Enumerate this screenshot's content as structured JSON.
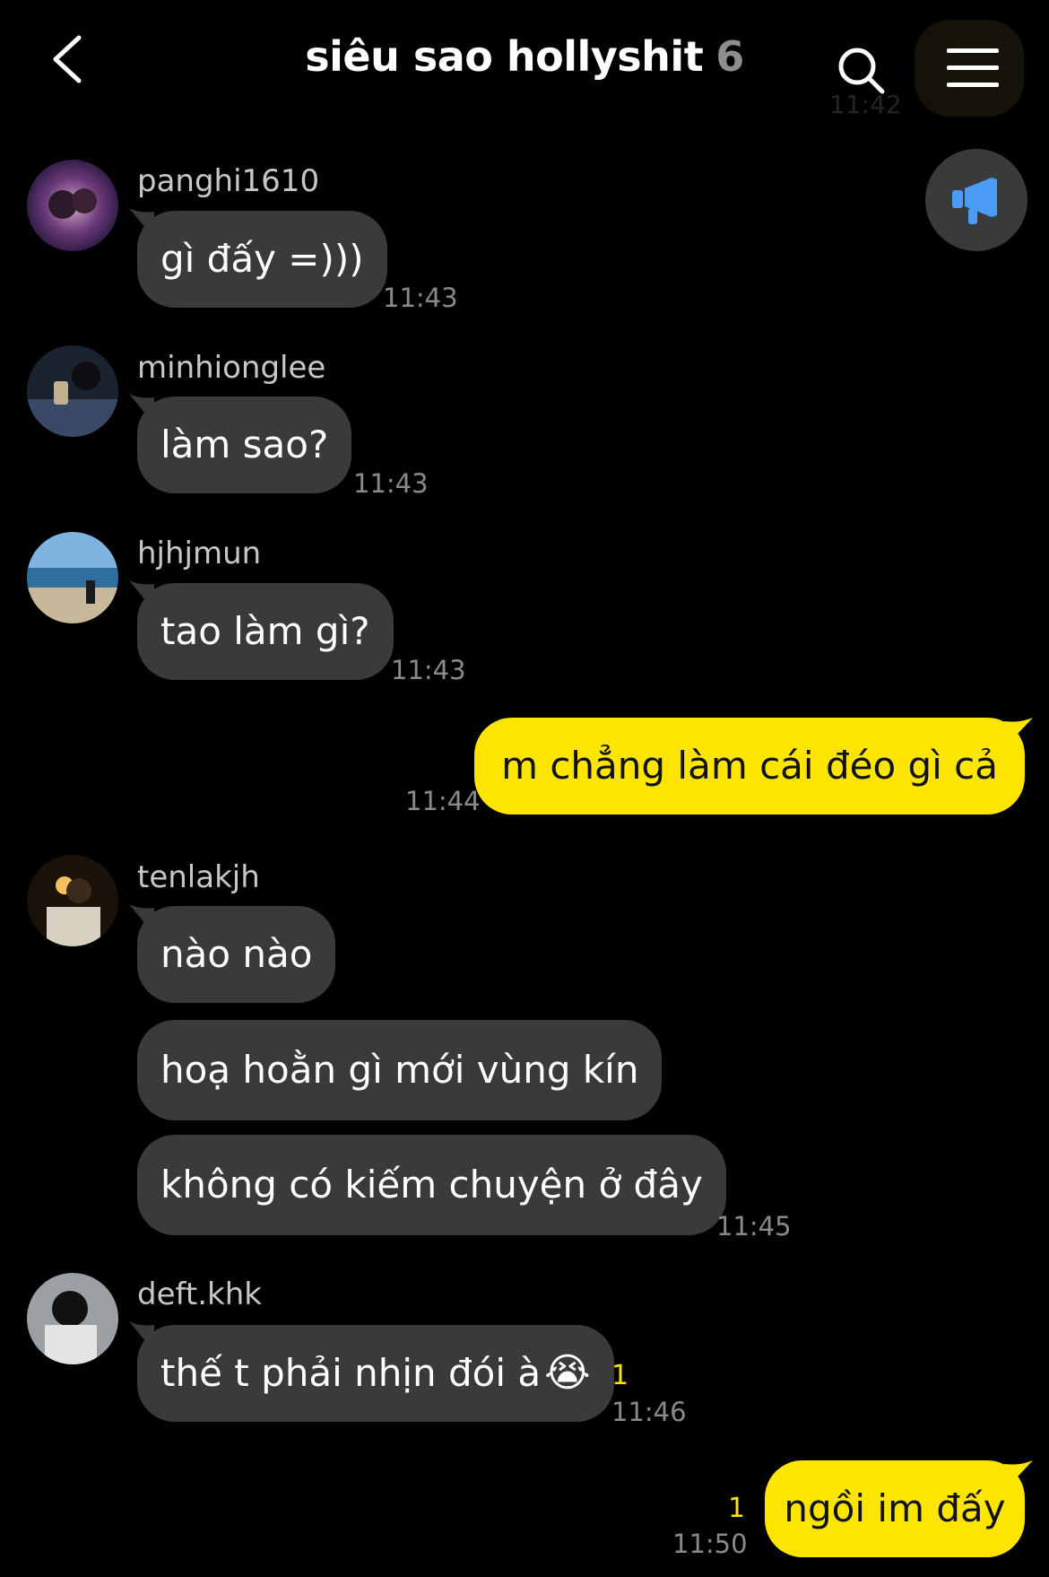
{
  "header": {
    "title": "siêu sao hollyshit",
    "member_count": "6",
    "back_icon": "chevron-left-icon",
    "search_icon": "search-icon",
    "menu_icon": "hamburger-menu-icon",
    "ghost_time": "11:42"
  },
  "notice_icon": "megaphone-icon",
  "colors": {
    "background": "#000000",
    "incoming_bubble": "#3a3a3c",
    "outgoing_bubble": "#fee500",
    "timestamp": "#8a8a8a",
    "unread": "#fee500"
  },
  "messages": [
    {
      "sender": "panghi1610",
      "text": "gì đấy =)))",
      "time": "11:43"
    },
    {
      "sender": "minhionglee",
      "text": "làm sao?",
      "time": "11:43"
    },
    {
      "sender": "hjhjmun",
      "text": "tao làm gì?",
      "time": "11:43"
    },
    {
      "sender": "me",
      "text": "m chẳng làm cái đéo gì cả",
      "time": "11:44"
    },
    {
      "sender": "tenlakjh",
      "lines": [
        "nào nào",
        "hoạ hoằn gì mới vùng kín",
        "không có kiếm chuyện ở đây"
      ],
      "time": "11:45"
    },
    {
      "sender": "deft.khk",
      "text": "thế t phải nhịn đói à",
      "emoji": "😭",
      "unread": "1",
      "time": "11:46"
    },
    {
      "sender": "me",
      "text": "ngồi im đấy",
      "unread": "1",
      "time": "11:50"
    }
  ]
}
